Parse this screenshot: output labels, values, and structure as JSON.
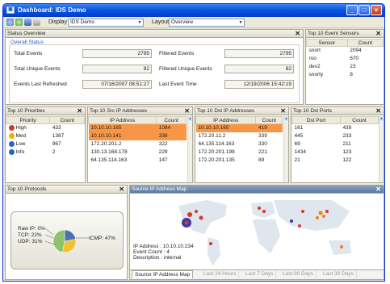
{
  "window": {
    "title": "Dashboard: IDS Demo"
  },
  "toolbar": {
    "display_label": "Display",
    "display_value": "IDS Demo",
    "layout_label": "Layout",
    "layout_value": "Overview"
  },
  "status_overview": {
    "title": "Status Overview",
    "group": "Overall Status",
    "total_events_label": "Total Events",
    "total_events": "2795",
    "filtered_events_label": "Filtered Events",
    "filtered_events": "2795",
    "total_unique_label": "Total Unique Events",
    "total_unique": "82",
    "filtered_unique_label": "Filtered Unique Events",
    "filtered_unique": "82",
    "last_refreshed_label": "Events Last Refreshed",
    "last_refreshed": "07/16/2007 08:51:27",
    "last_event_label": "Last Event Time",
    "last_event": "12/19/2006 15:42:19"
  },
  "event_sensors": {
    "title": "Top 10 Event Sensors",
    "columns": [
      "Sensor",
      "Count"
    ],
    "rows": [
      [
        "snort",
        "2094"
      ],
      [
        "roo",
        "670"
      ],
      [
        "dev2",
        "23"
      ],
      [
        "snorty",
        "8"
      ]
    ]
  },
  "priorities": {
    "title": "Top 10 Priorities",
    "columns": [
      "Priority",
      "Count"
    ],
    "rows": [
      {
        "icon": "high-priority-icon",
        "color": "#d03a20",
        "label": "High",
        "count": "433"
      },
      {
        "icon": "medium-warning-icon",
        "color": "#e8b400",
        "label": "Med",
        "count": "1387"
      },
      {
        "icon": "low-info-icon",
        "color": "#2a62c9",
        "label": "Low",
        "count": "967"
      },
      {
        "icon": "info-icon",
        "color": "#2a62c9",
        "label": "Info",
        "count": "2"
      }
    ]
  },
  "src_ips": {
    "title": "Top 10 Src IP Addresses",
    "columns": [
      "IP Address",
      "Count"
    ],
    "rows": [
      [
        "10.10.10.165",
        "1084"
      ],
      [
        "10.10.10.141",
        "338"
      ],
      [
        "172.20.201.2",
        "322"
      ],
      [
        "130.13.168.178",
        "229"
      ],
      [
        "64.135.114.163",
        "147"
      ]
    ]
  },
  "dst_ips": {
    "title": "Top 10 Dst IP Addresses",
    "columns": [
      "IP Address",
      "Count"
    ],
    "rows": [
      [
        "10.10.10.165",
        "419"
      ],
      [
        "172.20.11.2",
        "339"
      ],
      [
        "64.135.114.163",
        "330"
      ],
      [
        "172.20.201.198",
        "221"
      ],
      [
        "172.20.201.135",
        "89"
      ]
    ]
  },
  "dst_ports": {
    "title": "Top 10 Dst Ports",
    "columns": [
      "Dst Port",
      "Count"
    ],
    "rows": [
      [
        "161",
        "439"
      ],
      [
        "445",
        "233"
      ],
      [
        "69",
        "211"
      ],
      [
        "1434",
        "123"
      ],
      [
        "21",
        "122"
      ]
    ]
  },
  "protocols": {
    "title": "Top 10 Protocols",
    "slices": [
      {
        "label": "Raw IP: 0%",
        "value": 0,
        "color": "#7fb24a"
      },
      {
        "label": "TCP: 22%",
        "value": 22,
        "color": "#4b6fb8"
      },
      {
        "label": "UDP: 31%",
        "value": 31,
        "color": "#f1c232"
      },
      {
        "label": "ICMP: 47%",
        "value": 47,
        "color": "#8fc36b"
      }
    ]
  },
  "map": {
    "title": "Source IP Address Map",
    "info": {
      "ip_label": "IP Address",
      "ip": "10.10.10.234",
      "count_label": "Event Count",
      "count": "4",
      "desc_label": "Description",
      "desc": "internal"
    },
    "tabs": [
      "Source IP Address Map",
      "Last 24 Hours",
      "Last 7 Days",
      "Last 90 Days",
      "Last 30 Days"
    ]
  }
}
